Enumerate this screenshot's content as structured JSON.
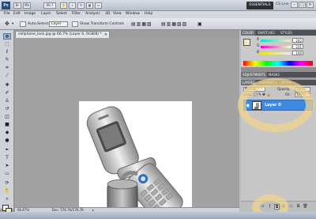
{
  "titlebar": {
    "logo": "Ps",
    "buttons": [
      "Br",
      "Mb",
      "66.7"
    ],
    "workspace": "ESSENTIALS",
    "cs_live": "CS Live",
    "controls": [
      "–",
      "□",
      "×"
    ]
  },
  "menu": [
    "File",
    "Edit",
    "Image",
    "Layer",
    "Select",
    "Filter",
    "Analysis",
    "3D",
    "View",
    "Window",
    "Help"
  ],
  "options": {
    "auto_select_label": "Auto-Select:",
    "auto_select_value": "Layer",
    "show_transform": "Show Transform Controls"
  },
  "document": {
    "tab_title": "cellphone_lock.jpg @ 66.7% (Layer 0, RGB/8) *",
    "close": "×"
  },
  "status": {
    "zoom": "66.67%",
    "doc_size": "Doc: 576.7K/576.7K"
  },
  "panels": {
    "top_tabs": [
      "COLOR",
      "SWATCHES",
      "STYLES"
    ],
    "color": {
      "channels": [
        {
          "label": "R",
          "value": "242"
        },
        {
          "label": "G",
          "value": "231"
        },
        {
          "label": "B",
          "value": "196"
        }
      ],
      "fg": "#f0e7c4",
      "bg": "#ffffff"
    },
    "mid_tabs": [
      "ADJUSTMENTS",
      "MASKS"
    ],
    "layer_tabs": [
      "LAYERS",
      "CHANNELS",
      "PATHS"
    ],
    "layers": {
      "blend_mode": "Normal",
      "opacity_label": "Opacity:",
      "opacity_value": "100%",
      "lock_label": "Lock:",
      "fill_label": "Fill:",
      "fill_value": "100%",
      "items": [
        {
          "name": "Layer 0",
          "selected": true,
          "visible": true
        }
      ]
    }
  },
  "colors": {
    "layer_selected": "#3d88e2",
    "highlight": "#f2d58c"
  }
}
